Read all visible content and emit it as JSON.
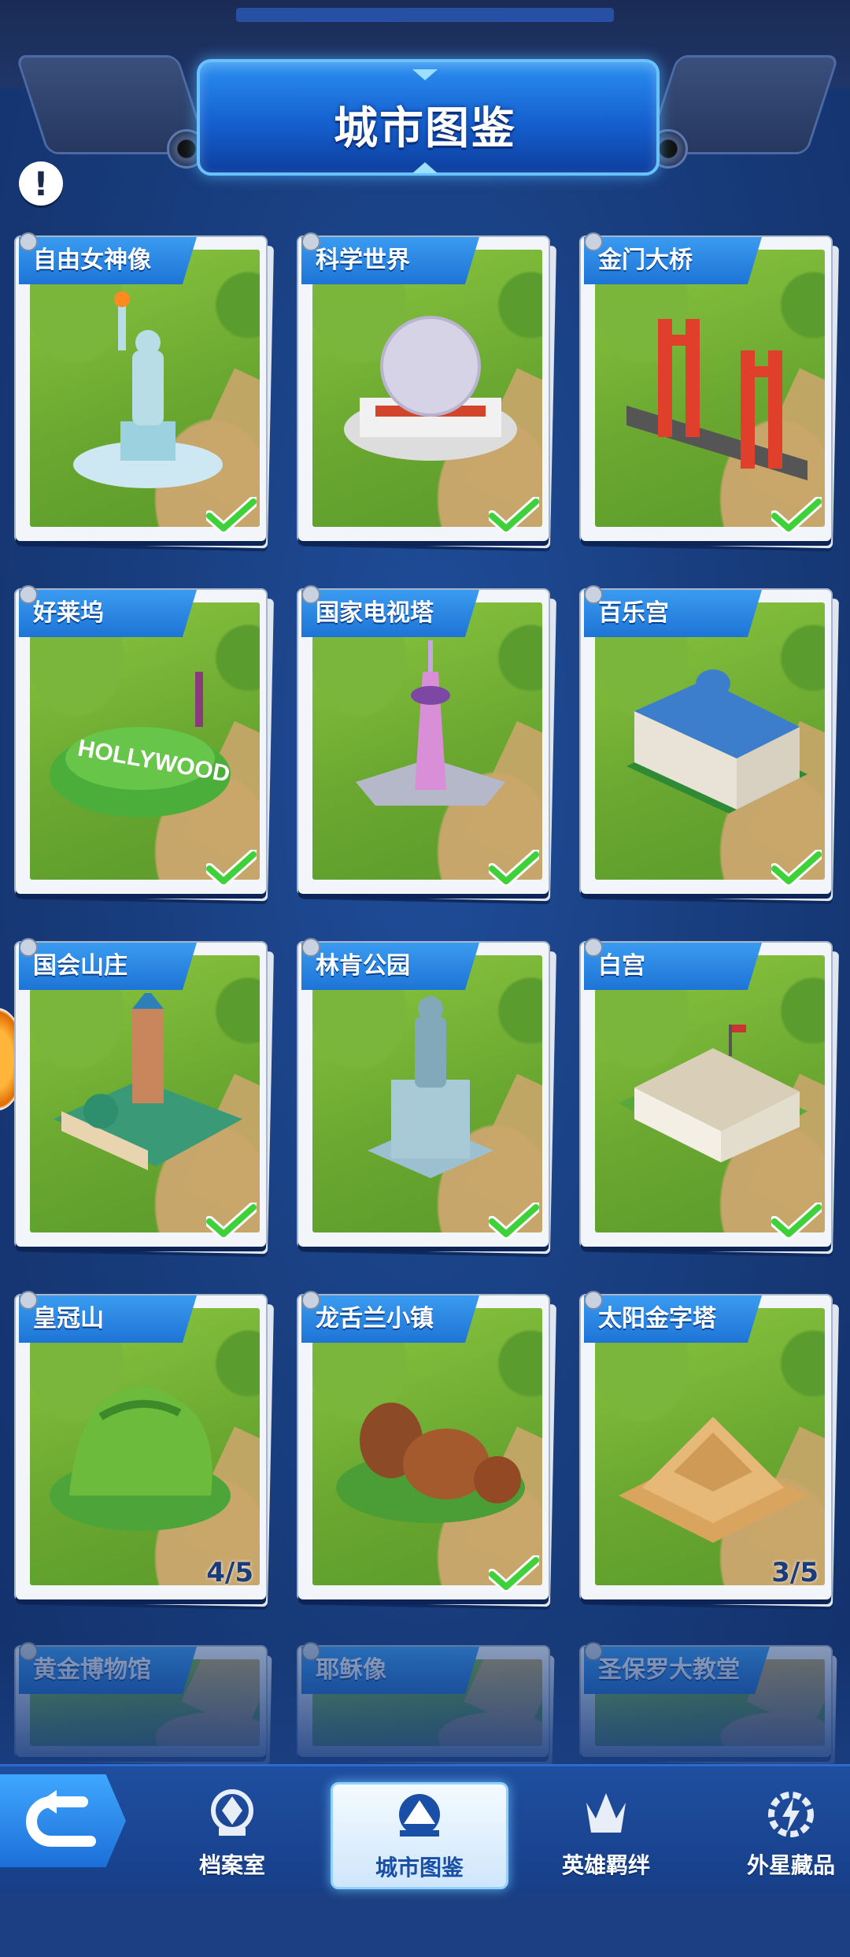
{
  "header": {
    "title": "城市图鉴"
  },
  "info_button": {
    "symbol": "!"
  },
  "landmarks": [
    {
      "name": "自由女神像",
      "status": "complete",
      "art": "statue-of-liberty"
    },
    {
      "name": "科学世界",
      "status": "complete",
      "art": "science-world-dome"
    },
    {
      "name": "金门大桥",
      "status": "complete",
      "art": "golden-gate-bridge"
    },
    {
      "name": "好莱坞",
      "status": "complete",
      "art": "hollywood-hill"
    },
    {
      "name": "国家电视塔",
      "status": "complete",
      "art": "tv-tower"
    },
    {
      "name": "百乐宫",
      "status": "complete",
      "art": "bellagio-hotel"
    },
    {
      "name": "国会山庄",
      "status": "complete",
      "art": "capitol-building"
    },
    {
      "name": "林肯公园",
      "status": "complete",
      "art": "lincoln-statue"
    },
    {
      "name": "白宫",
      "status": "complete",
      "art": "white-house"
    },
    {
      "name": "皇冠山",
      "status": "progress",
      "progress": "4/5",
      "art": "crown-mountain"
    },
    {
      "name": "龙舌兰小镇",
      "status": "complete",
      "art": "tequila-barrels"
    },
    {
      "name": "太阳金字塔",
      "status": "progress",
      "progress": "3/5",
      "art": "sun-pyramid"
    },
    {
      "name": "黄金博物馆",
      "status": "partial-visible",
      "art": ""
    },
    {
      "name": "耶稣像",
      "status": "partial-visible",
      "art": ""
    },
    {
      "name": "圣保罗大教堂",
      "status": "partial-visible",
      "art": ""
    }
  ],
  "bottom_nav": {
    "tabs": [
      {
        "label": "档案室",
        "icon": "archive-icon",
        "active": false
      },
      {
        "label": "城市图鉴",
        "icon": "city-catalog-icon",
        "active": true
      },
      {
        "label": "英雄羁绊",
        "icon": "hero-bond-icon",
        "active": false
      },
      {
        "label": "外星藏品",
        "icon": "alien-collection-icon",
        "active": false
      }
    ]
  },
  "colors": {
    "accent": "#1e74d6",
    "check_green": "#3fd13a",
    "background": "#1b3f82"
  }
}
